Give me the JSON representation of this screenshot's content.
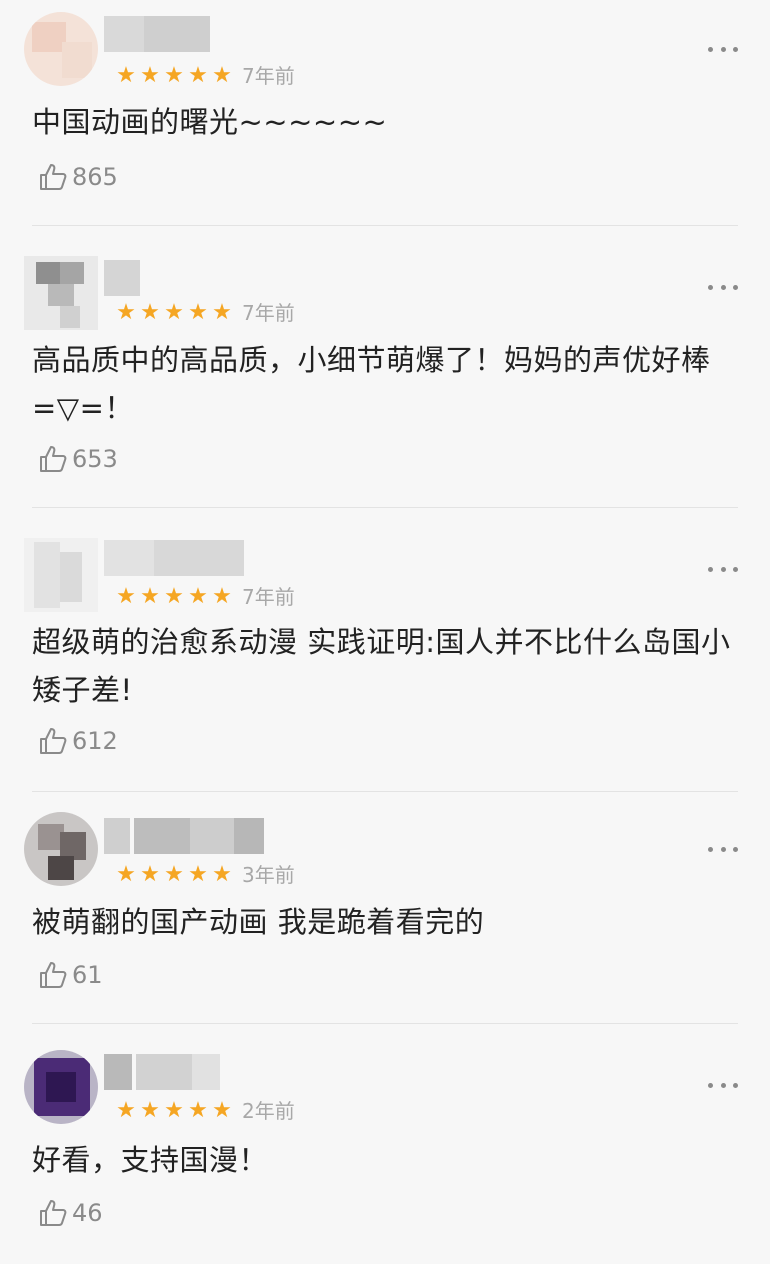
{
  "colors": {
    "background": "#f7f7f7",
    "star": "#f5a623",
    "muted": "#a8a8a8",
    "divider": "#e3e3e3"
  },
  "icons": {
    "rating": "star-icon",
    "more": "more-dots-icon",
    "like": "thumbs-up-icon"
  },
  "reviews": [
    {
      "stars": 5,
      "star_glyphs": [
        "★",
        "★",
        "★",
        "★",
        "★"
      ],
      "time": "7年前",
      "content": "中国动画的曙光~~~~~~",
      "likes": "865"
    },
    {
      "stars": 5,
      "star_glyphs": [
        "★",
        "★",
        "★",
        "★",
        "★"
      ],
      "time": "7年前",
      "content": "高品质中的高品质，小细节萌爆了！妈妈的声优好棒=▽=！",
      "likes": "653"
    },
    {
      "stars": 5,
      "star_glyphs": [
        "★",
        "★",
        "★",
        "★",
        "★"
      ],
      "time": "7年前",
      "content": "超级萌的治愈系动漫 实践证明:国人并不比什么岛国小矮子差!",
      "likes": "612"
    },
    {
      "stars": 5,
      "star_glyphs": [
        "★",
        "★",
        "★",
        "★",
        "★"
      ],
      "time": "3年前",
      "content": "被萌翻的国产动画 我是跪着看完的",
      "likes": "61"
    },
    {
      "stars": 5,
      "star_glyphs": [
        "★",
        "★",
        "★",
        "★",
        "★"
      ],
      "time": "2年前",
      "content": "好看，支持国漫！",
      "likes": "46"
    }
  ]
}
